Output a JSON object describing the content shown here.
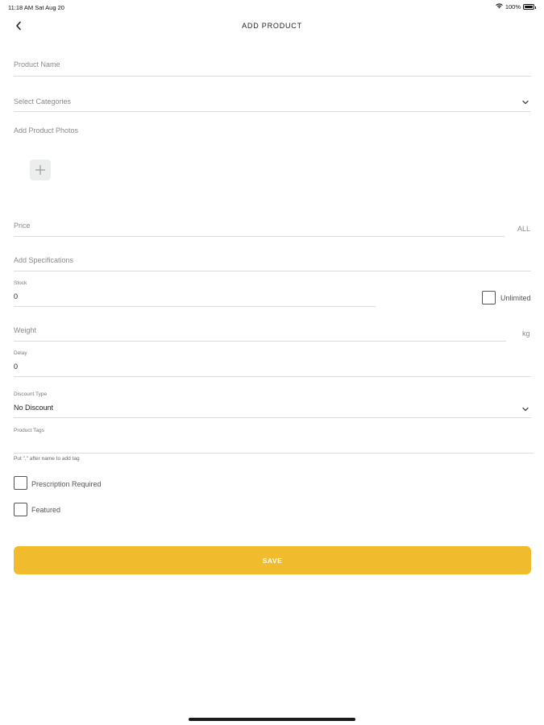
{
  "status_bar": {
    "time_date": "11:18 AM   Sat Aug 20",
    "battery": "100%"
  },
  "nav": {
    "title": "ADD PRODUCT"
  },
  "form": {
    "product_name": {
      "placeholder": "Product Name"
    },
    "categories": {
      "placeholder": "Select Categories"
    },
    "photos": {
      "label": "Add Product Photos"
    },
    "price": {
      "placeholder": "Price",
      "currency": "ALL"
    },
    "specifications": {
      "placeholder": "Add Specifications"
    },
    "stock": {
      "label": "Stock",
      "value": "0",
      "unlimited_label": "Unlimited"
    },
    "weight": {
      "placeholder": "Weight",
      "unit": "kg"
    },
    "delay": {
      "label": "Delay",
      "value": "0"
    },
    "discount": {
      "label": "Discount Type",
      "value": "No Discount"
    },
    "tags": {
      "label": "Product Tags",
      "hint": "Put \",\" after name to add tag"
    },
    "prescription": {
      "label": "Prescription Required"
    },
    "featured": {
      "label": "Featured"
    }
  },
  "save_button": {
    "label": "SAVE"
  },
  "colors": {
    "accent": "#f0bb2c",
    "divider": "#dcdcdc"
  }
}
